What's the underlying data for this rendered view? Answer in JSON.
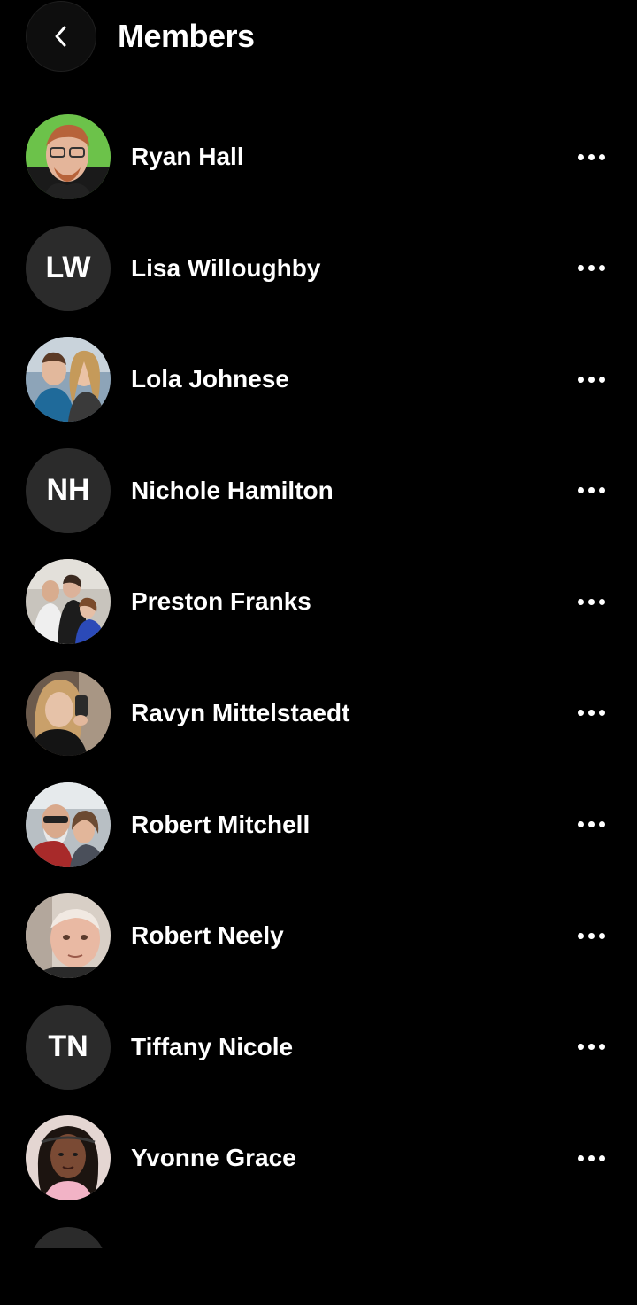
{
  "header": {
    "title": "Members",
    "back_icon": "chevron-left-icon"
  },
  "members": [
    {
      "name": "Ryan Hall",
      "avatar_type": "photo",
      "avatar_color": "#6cc24a"
    },
    {
      "name": "Lisa Willoughby",
      "avatar_type": "initials",
      "initials": "LW"
    },
    {
      "name": "Lola Johnese",
      "avatar_type": "photo",
      "avatar_color": "#6f8fb0"
    },
    {
      "name": "Nichole Hamilton",
      "avatar_type": "initials",
      "initials": "NH"
    },
    {
      "name": "Preston Franks",
      "avatar_type": "photo",
      "avatar_color": "#b9b6b0"
    },
    {
      "name": "Ravyn Mittelstaedt",
      "avatar_type": "photo",
      "avatar_color": "#5a4a3e"
    },
    {
      "name": "Robert Mitchell",
      "avatar_type": "photo",
      "avatar_color": "#9aa2a8"
    },
    {
      "name": "Robert Neely",
      "avatar_type": "photo",
      "avatar_color": "#c9b6a8"
    },
    {
      "name": "Tiffany Nicole",
      "avatar_type": "initials",
      "initials": "TN"
    },
    {
      "name": "Yvonne Grace",
      "avatar_type": "photo",
      "avatar_color": "#d9c7c4"
    }
  ],
  "more_icon": "more-horizontal-icon",
  "colors": {
    "background": "#000000",
    "text": "#ffffff",
    "initials_bg": "#2b2b2b"
  }
}
